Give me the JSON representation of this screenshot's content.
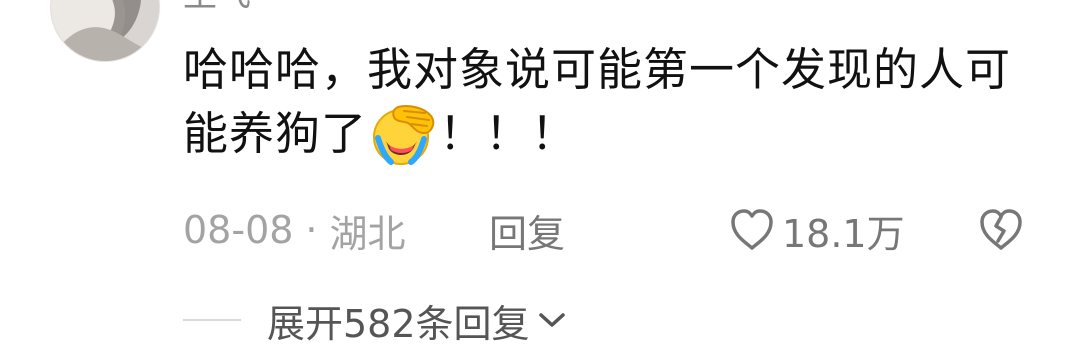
{
  "comment": {
    "username": "王飞",
    "text_before_emoji": "哈哈哈，我对象说可能第一个发现的人可能养狗了",
    "emoji": "face-palm-crying-laughing-emoji",
    "text_after_emoji": "！！！",
    "date": "08-08",
    "separator": "·",
    "location": "湖北",
    "reply_label": "回复",
    "like_count": "18.1万",
    "expand_replies_label": "展开582条回复"
  },
  "icons": {
    "like": "heart-outline-icon",
    "dislike": "broken-heart-icon",
    "expand": "chevron-down-icon"
  },
  "colors": {
    "text": "#111111",
    "meta_text": "#a3a3a3",
    "action_text": "#777777",
    "expand_text": "#555555"
  }
}
